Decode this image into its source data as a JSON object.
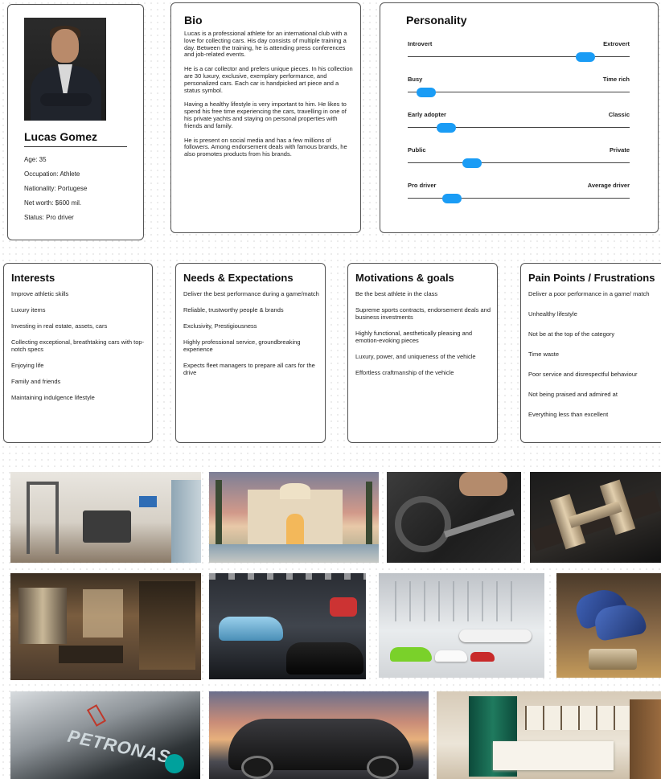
{
  "profile": {
    "name": "Lucas Gomez",
    "facts": [
      "Age: 35",
      "Occupation: Athlete",
      "Nationality: Portugese",
      "Net worth: $600 mil.",
      "Status: Pro driver"
    ]
  },
  "bio": {
    "title": "Bio",
    "paragraphs": [
      "Lucas is a professional athlete for an international club with a love for collecting cars. His day consists of multiple training a day. Between the training, he is attending press conferences and job-related events.",
      "He is a car collector and prefers unique pieces. In his collection are 30 luxury, exclusive, exemplary performance, and personalized cars. Each car is handpicked art piece and a status symbol.",
      "Having a healthy lifestyle is very important to him. He likes to spend his free time experiencing the cars, travelling in one of his private yachts and staying on personal properties with friends and family.",
      "He is present on social media and has a few millions of followers. Among endorsement deals with famous brands, he also promotes products from his brands."
    ]
  },
  "personality": {
    "title": "Personality",
    "sliders": [
      {
        "left": "Introvert",
        "right": "Extrovert",
        "value": 0.8
      },
      {
        "left": "Busy",
        "right": "Time rich",
        "value": 0.085
      },
      {
        "left": "Early adopter",
        "right": "Classic",
        "value": 0.175
      },
      {
        "left": "Public",
        "right": "Private",
        "value": 0.29
      },
      {
        "left": "Pro driver",
        "right": "Average driver",
        "value": 0.2
      }
    ],
    "accent": "#1a9cf5"
  },
  "interests": {
    "title": "Interests",
    "items": [
      "Improve athletic skills",
      "Luxury items",
      "Investing in real estate, assets, cars",
      "Collecting exceptional, breathtaking cars with top-notch specs",
      "Enjoying life",
      "Family and friends",
      "Maintaining indulgence lifestyle"
    ]
  },
  "needs": {
    "title": "Needs & Expectations",
    "items": [
      "Deliver the best performance during a game/match",
      "Reliable, trustworthy people & brands",
      "Exclusivity, Prestigiousness",
      "Highly professional service, groundbreaking experience",
      "Expects fleet managers to prepare all cars for the drive"
    ]
  },
  "motivations": {
    "title": "Motivations & goals",
    "items": [
      "Be the best athlete in the class",
      "Supreme sports contracts, endorsement deals and business investments",
      "Highly functional, aesthetically pleasing and emotion-evoking pieces",
      "Luxury, power, and uniqueness of the vehicle",
      "Effortless craftmanship of the vehicle"
    ]
  },
  "painpoints": {
    "title": "Pain Points / Frustrations",
    "items": [
      "Deliver a poor performance in a game/ match",
      "Unhealthy lifestyle",
      "Not be at the top of the category",
      "Time waste",
      "Poor service and disrespectful behaviour",
      "Not being praised and admired at",
      "Everything less than excellent"
    ]
  },
  "gallery": {
    "images": [
      "home-gym-photo",
      "mansion-photo",
      "rowing-machine-photo",
      "leather-belt-photo",
      "luxury-boutique-photo",
      "car-garage-photo",
      "private-jet-hangar-photo",
      "luxury-shoes-photo",
      "petronas-race-car-photo",
      "hypercar-sunset-photo",
      "watch-boutique-photo"
    ],
    "petronas_text": "PETRONAS"
  }
}
